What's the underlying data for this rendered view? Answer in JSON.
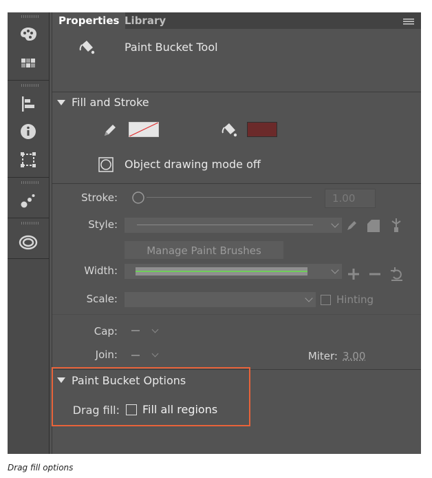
{
  "tabs": [
    {
      "label": "Properties"
    },
    {
      "label": "Library"
    }
  ],
  "tool": {
    "name": "Paint Bucket Tool"
  },
  "fill_and_stroke": {
    "title": "Fill and Stroke",
    "stroke_color": "none",
    "fill_color": "#6b2a2a",
    "object_drawing": "Object drawing mode off"
  },
  "stroke": {
    "label": "Stroke:",
    "value": "1.00"
  },
  "style": {
    "label": "Style:",
    "manage_brushes": "Manage Paint Brushes"
  },
  "width": {
    "label": "Width:"
  },
  "scale": {
    "label": "Scale:",
    "hinting": "Hinting"
  },
  "cap": {
    "label": "Cap:"
  },
  "join": {
    "label": "Join:"
  },
  "miter": {
    "label": "Miter:",
    "value": "3.00"
  },
  "paint_bucket_options": {
    "title": "Paint Bucket Options",
    "drag_fill_label": "Drag fill:",
    "fill_all_regions": "Fill all regions"
  },
  "caption": "Drag fill options",
  "toolstrip_icons": [
    "palette-icon",
    "swatches-icon",
    "align-icon",
    "info-icon",
    "transform-icon",
    "motion-presets-icon",
    "creative-cloud-icon"
  ]
}
